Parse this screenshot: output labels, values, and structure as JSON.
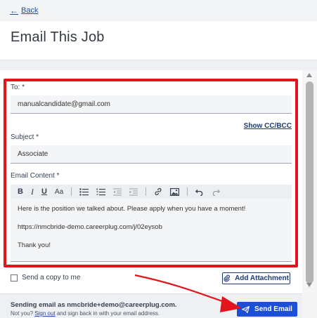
{
  "nav": {
    "back_label": "Back"
  },
  "page": {
    "title": "Email This Job"
  },
  "form": {
    "to_label": "To: *",
    "to_value": "manualcandidate@gmail.com",
    "show_cc_label": "Show CC/BCC",
    "subject_label": "Subject *",
    "subject_value": "Associate",
    "content_label": "Email Content *",
    "body": {
      "line1": "Here is the position we talked about. Please apply when you have a moment!",
      "line2": "https://nmcbride-demo.careerplug.com/j/02eysob",
      "line3": "Thank you!"
    },
    "toolbar": {
      "bold": "B",
      "italic": "I",
      "underline": "U",
      "font_size": "Aa",
      "icons": [
        "bullet-list-icon",
        "numbered-list-icon",
        "outdent-icon",
        "indent-icon",
        "link-icon",
        "image-icon",
        "undo-icon",
        "redo-icon"
      ]
    },
    "copy_label": "Send a copy to me",
    "attach_label": "Add Attachment"
  },
  "footer": {
    "sending_text": "Sending email as nmcbride+demo@careerplug.com.",
    "notyou_prefix": "Not you?",
    "signout_label": "Sign out",
    "notyou_suffix": "and sign back in with your email address.",
    "send_label": "Send Email"
  },
  "colors": {
    "accent": "#1d4ed8",
    "highlight": "#e3141c",
    "link": "#1e4fa8"
  }
}
